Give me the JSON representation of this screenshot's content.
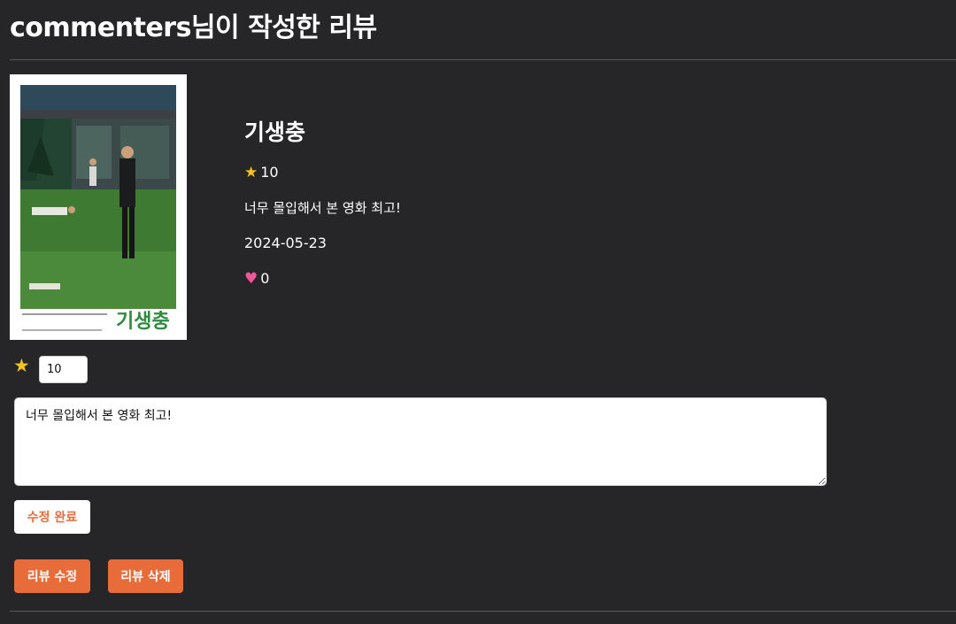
{
  "header": {
    "title": "commenters님이 작성한 리뷰"
  },
  "review": {
    "movie_title": "기생충",
    "poster_title_text": "기생충",
    "rating_icon": "star-icon",
    "rating": "10",
    "content": "너무 몰입해서 본 영화 최고!",
    "date": "2024-05-23",
    "likes_icon": "heart-icon",
    "likes": "0"
  },
  "edit_form": {
    "star_icon": "star-icon",
    "rating_value": "10",
    "content_value": "너무 몰입해서 본 영화 최고!",
    "submit_label": "수정 완료"
  },
  "actions": {
    "edit_label": "리뷰 수정",
    "delete_label": "리뷰 삭제"
  },
  "colors": {
    "background": "#262628",
    "accent": "#e86b3a",
    "star": "#f5c518",
    "heart": "#f2559a"
  }
}
